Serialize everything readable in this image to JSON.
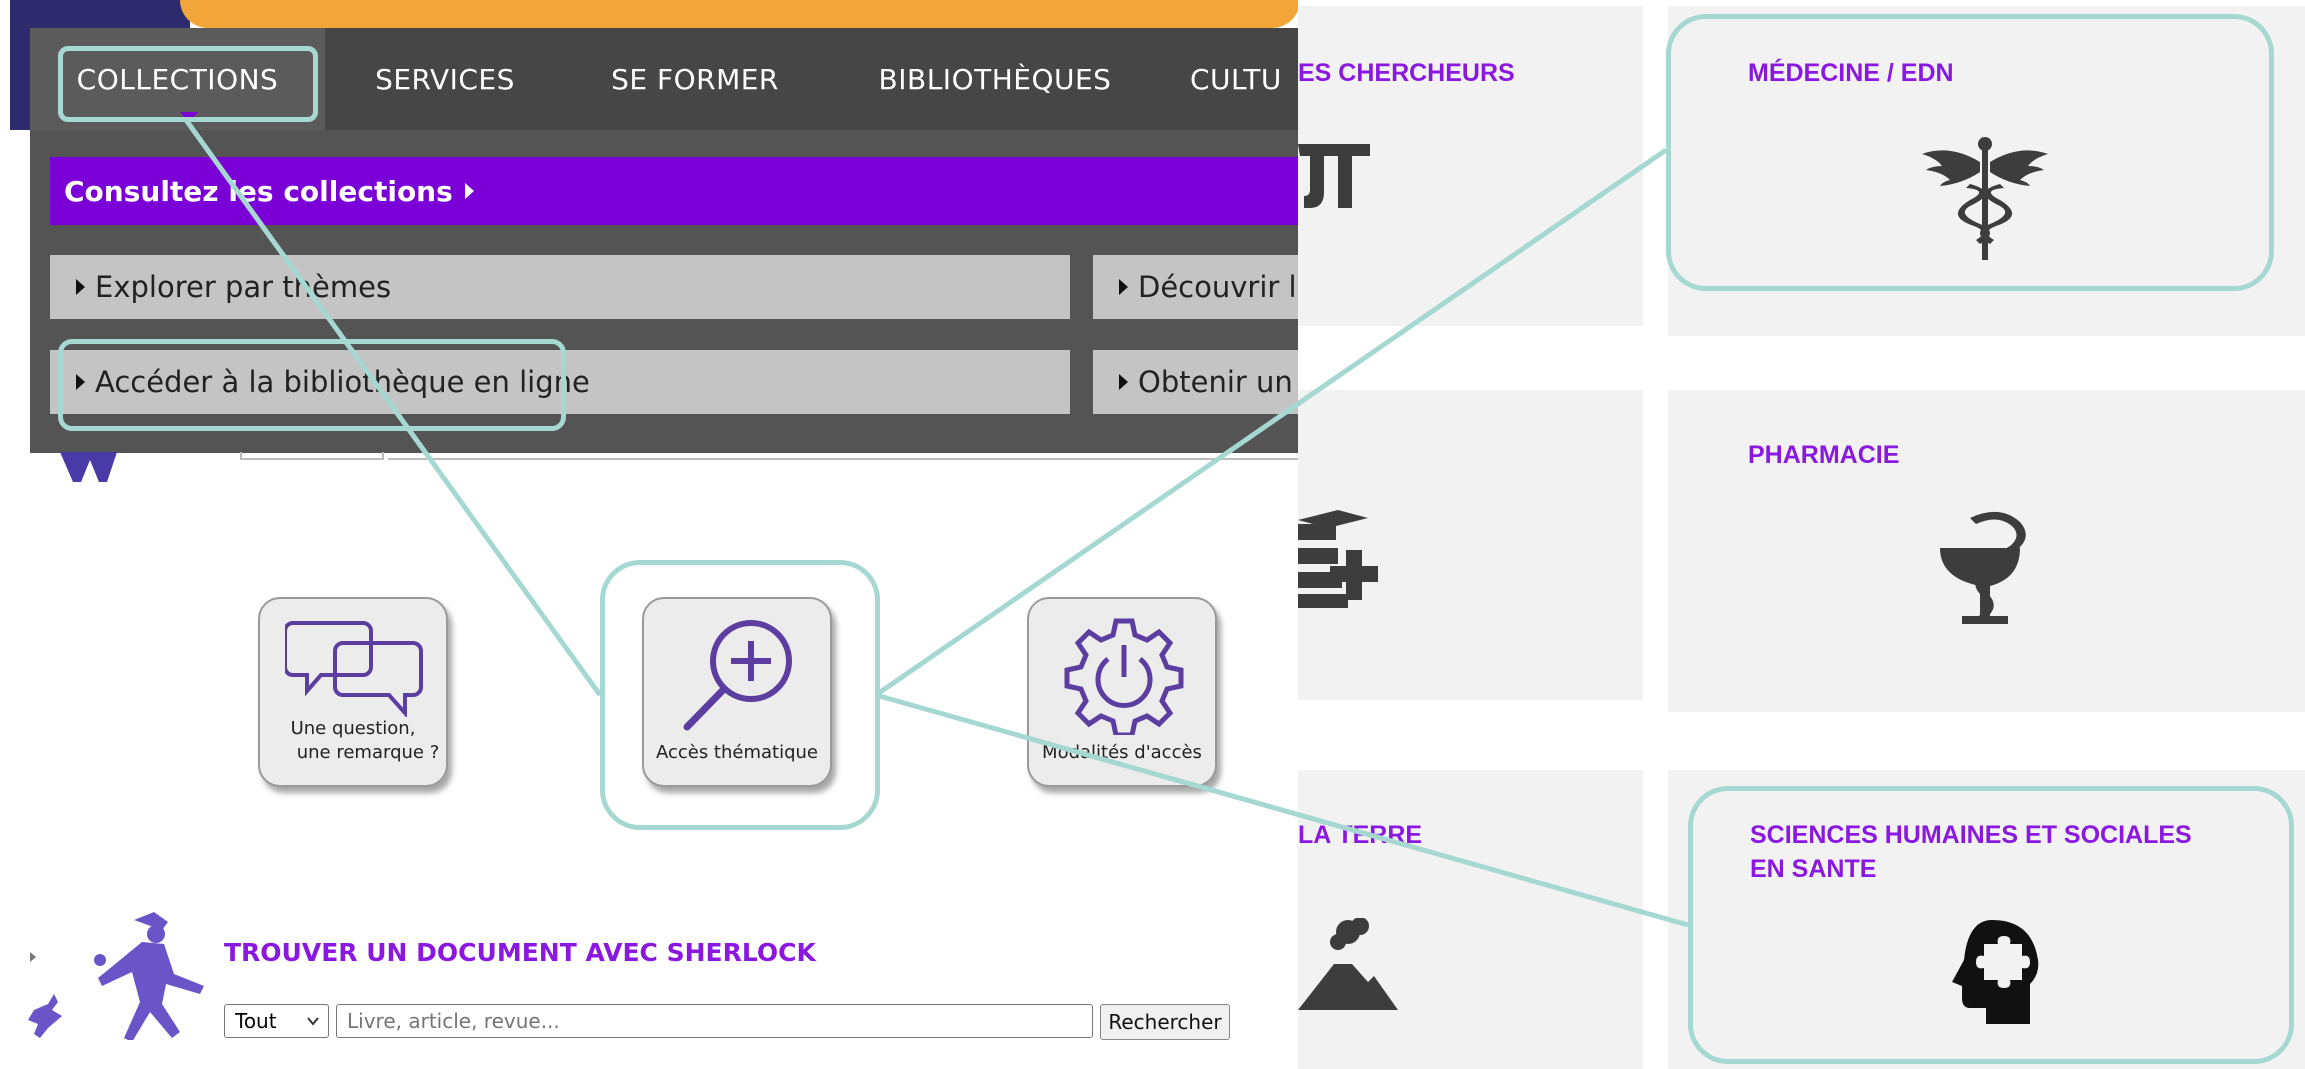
{
  "nav": {
    "items": [
      {
        "label": "COLLECTIONS"
      },
      {
        "label": "SERVICES"
      },
      {
        "label": "SE FORMER"
      },
      {
        "label": "BIBLIOTHÈQUES"
      },
      {
        "label": "CULTU"
      }
    ]
  },
  "submenu": {
    "heading": "Consultez les collections",
    "links": [
      {
        "label": "Explorer par thèmes"
      },
      {
        "label": "Découvrir le"
      },
      {
        "label": "Accéder à la bibliothèque en ligne"
      },
      {
        "label": "Obtenir un d"
      }
    ]
  },
  "quick_tiles": [
    {
      "label_line1": "Une question,",
      "label_line2": "une remarque ?",
      "icon": "speech-bubbles-icon"
    },
    {
      "label_line1": "Accès thématique",
      "label_line2": "",
      "icon": "magnifier-plus-icon"
    },
    {
      "label_line1": "Modalités d'accès",
      "label_line2": "",
      "icon": "gear-power-icon"
    }
  ],
  "sherlock": {
    "title": "TROUVER UN DOCUMENT AVEC SHERLOCK",
    "select_value": "Tout",
    "search_placeholder": "Livre, article, revue...",
    "search_button": "Rechercher"
  },
  "cards": [
    {
      "title": "ES CHERCHEURS",
      "icon": "pi-icon"
    },
    {
      "title": "MÉDECINE / EDN",
      "icon": "caduceus-icon"
    },
    {
      "title": "",
      "icon": "books-plus-icon"
    },
    {
      "title": "PHARMACIE",
      "icon": "bowl-of-hygieia-icon"
    },
    {
      "title": "LA TERRE",
      "icon": "volcano-icon"
    },
    {
      "title": "SCIENCES HUMAINES ET SOCIALES EN SANTE",
      "icon": "head-puzzle-icon"
    }
  ],
  "colors": {
    "accent_purple": "#7b00d8",
    "title_purple": "#8a18e0",
    "nav_dark": "#474647",
    "highlight": "#a6d8d2",
    "card_bg": "#f2f2f2"
  }
}
